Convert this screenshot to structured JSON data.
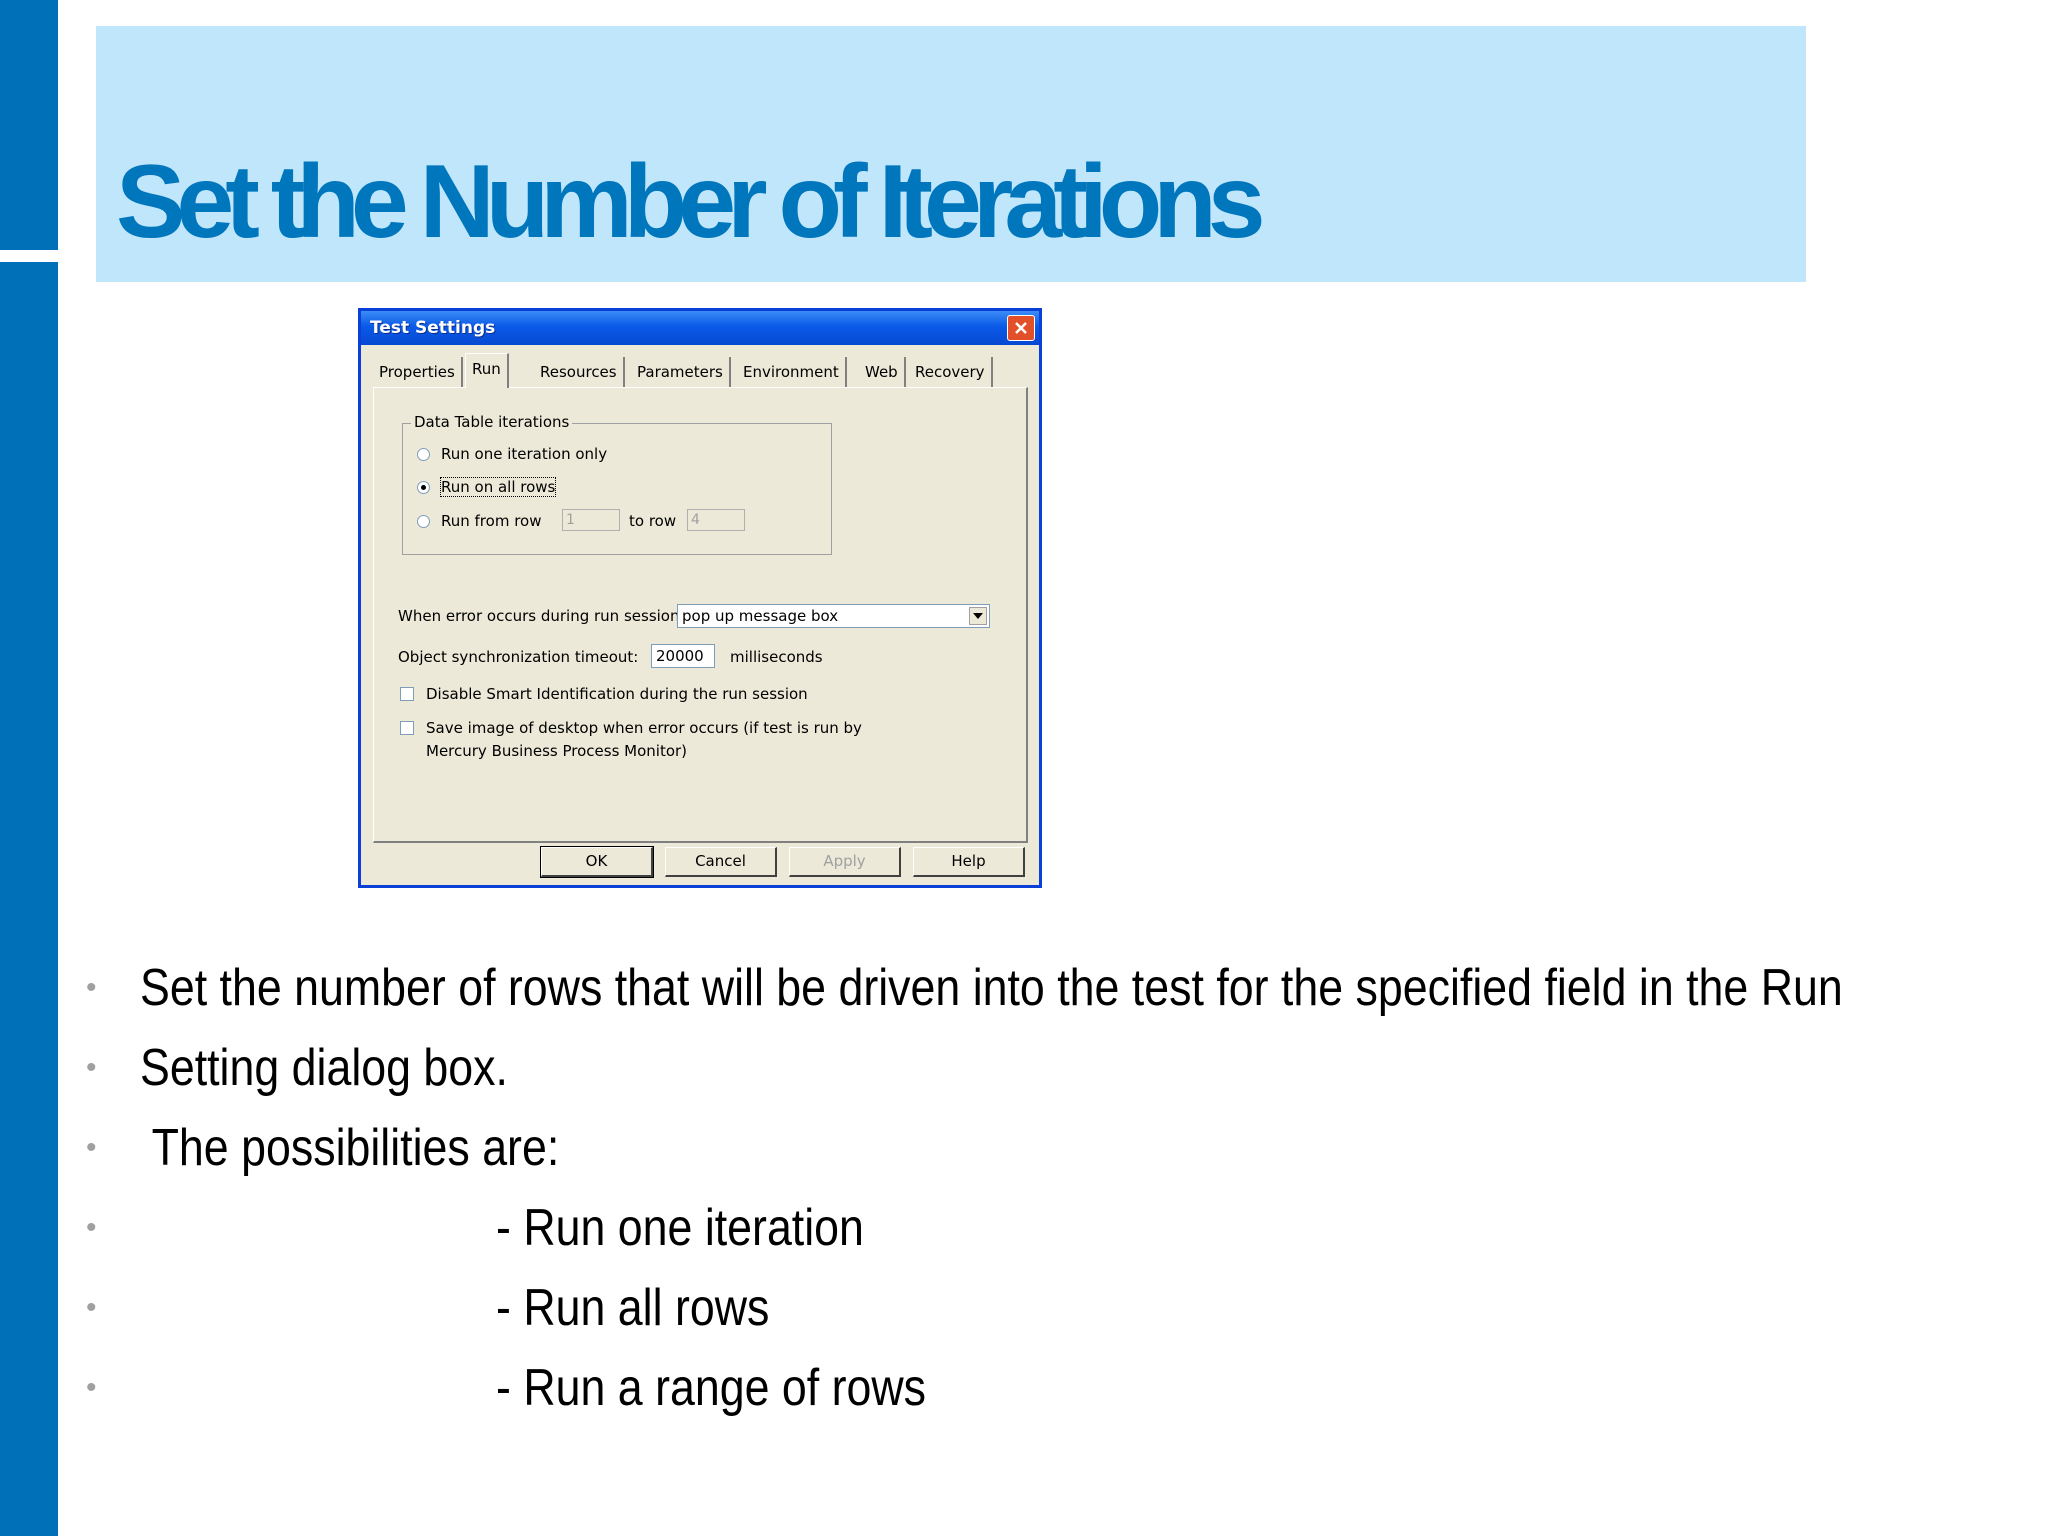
{
  "slide": {
    "title": "Set the Number of Iterations"
  },
  "dialog": {
    "title": "Test Settings",
    "tabs": [
      "Properties",
      "Run",
      "Resources",
      "Parameters",
      "Environment",
      "Web",
      "Recovery"
    ],
    "active_tab": "Run",
    "group_label": "Data Table iterations",
    "radio_one": "Run one iteration only",
    "radio_all": "Run on all rows",
    "radio_range": "Run from row",
    "range_from": "1",
    "range_to_label": "to row",
    "range_to": "4",
    "selected_radio": "Run on all rows",
    "error_label": "When error occurs during run session:",
    "error_value": "pop up message box",
    "sync_label": "Object synchronization timeout:",
    "sync_value": "20000",
    "sync_unit": "milliseconds",
    "check_smart": "Disable Smart Identification during the run session",
    "check_save_line1": "Save image of desktop when error occurs (if test is run by",
    "check_save_line2": "Mercury Business Process Monitor)",
    "buttons": {
      "ok": "OK",
      "cancel": "Cancel",
      "apply": "Apply",
      "help": "Help"
    }
  },
  "bullets": [
    "Set the number of rows that will be driven into the test for the specified field in the Run",
    "Setting dialog box.",
    " The possibilities are:",
    "- Run one iteration",
    "- Run all rows",
    "- Run a range of rows"
  ],
  "colors": {
    "accent_bar": "#0070b8",
    "title_band": "#bfe6fb",
    "title_text": "#0076bd"
  }
}
